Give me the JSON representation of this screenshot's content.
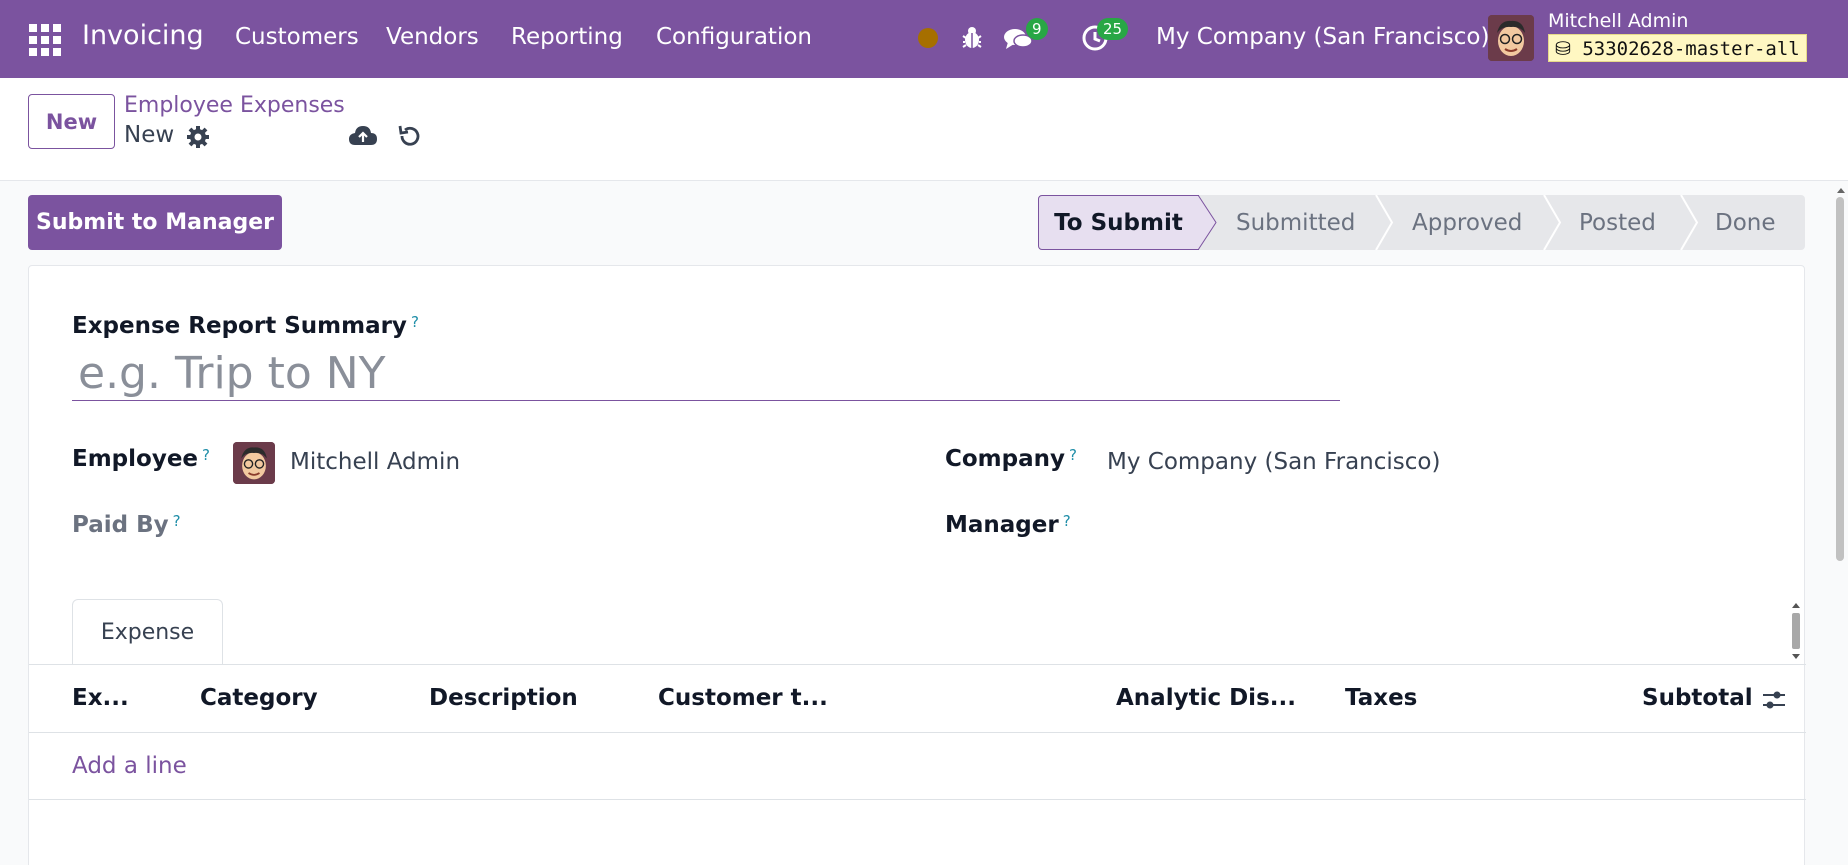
{
  "navbar": {
    "app_name": "Invoicing",
    "menus": [
      "Customers",
      "Vendors",
      "Reporting",
      "Configuration"
    ],
    "messages_count": "9",
    "activities_count": "25",
    "company": "My Company (San Francisco)",
    "user_name": "Mitchell Admin",
    "database": "53302628-master-all"
  },
  "control_panel": {
    "new_label": "New",
    "breadcrumb_parent": "Employee Expenses",
    "breadcrumb_current": "New"
  },
  "status": {
    "submit_label": "Submit to Manager",
    "stages": [
      "To Submit",
      "Submitted",
      "Approved",
      "Posted",
      "Done"
    ],
    "active_stage": "To Submit"
  },
  "form": {
    "summary_label": "Expense Report Summary",
    "summary_placeholder": "e.g. Trip to NY",
    "help_mark": "?",
    "employee_label": "Employee",
    "employee_value": "Mitchell Admin",
    "paid_by_label": "Paid By",
    "company_label": "Company",
    "company_value": "My Company (San Francisco)",
    "manager_label": "Manager"
  },
  "tabs": [
    "Expense"
  ],
  "table": {
    "columns": [
      "Ex...",
      "Category",
      "Description",
      "Customer t...",
      "Analytic Dis...",
      "Taxes",
      "Subtotal"
    ],
    "add_line": "Add a line"
  },
  "colors": {
    "brand": "#7b539f",
    "badge": "#28a745",
    "help": "#1f8ea8"
  }
}
